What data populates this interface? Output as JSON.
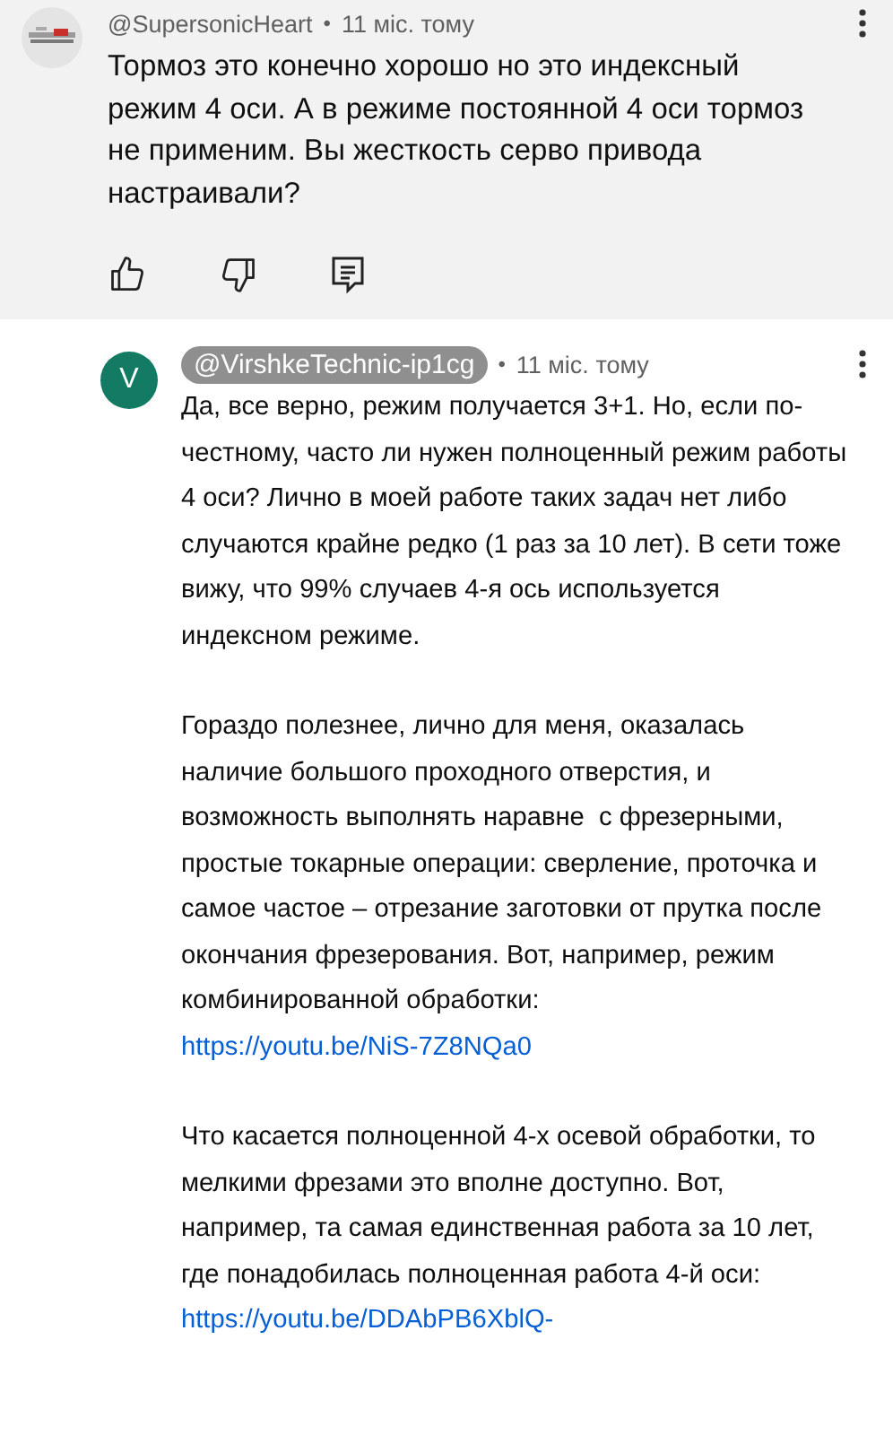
{
  "comment": {
    "author": "@SupersonicHeart",
    "separator": "•",
    "time": "11 міс. тому",
    "text": "Тормоз это конечно хорошо но это индексный режим 4 оси. А в режиме постоянной 4 оси тормоз не применим. Вы жесткость серво привода настраивали?"
  },
  "reply": {
    "avatar_letter": "V",
    "author": "@VirshkeTechnic-ip1cg",
    "author_highlighted": true,
    "separator": "•",
    "time": "11 міс. тому",
    "paragraphs": [
      {
        "parts": [
          {
            "kind": "text",
            "text": "Да, все верно, режим получается 3+1. Но, если по-честному, часто ли нужен полноценный режим работы 4 оси? Лично в моей работе таких задач нет либо случаются крайне редко (1 раз за 10 лет). В сети тоже вижу, что 99% случаев 4-я ось используется индексном режиме."
          }
        ]
      },
      {
        "parts": [
          {
            "kind": "text",
            "text": "Гораздо полезнее, лично для меня, оказалась наличие большого проходного отверстия, и возможность выполнять наравне  с фрезерными, простые токарные операции: сверление, проточка и самое частое – отрезание заготовки от прутка после окончания фрезерования. Вот, например, режим комбинированной обработки: "
          },
          {
            "kind": "link",
            "text": "https://youtu.be/NiS-7Z8NQa0"
          }
        ]
      },
      {
        "parts": [
          {
            "kind": "text",
            "text": "Что касается полноценной 4-х осевой обработки, то мелкими фрезами это вполне доступно. Вот, например, та самая единственная работа за 10 лет, где понадобилась полноценная работа 4-й оси: "
          },
          {
            "kind": "link",
            "text": "https://youtu.be/DDAbPB6XblQ-"
          }
        ]
      }
    ]
  }
}
